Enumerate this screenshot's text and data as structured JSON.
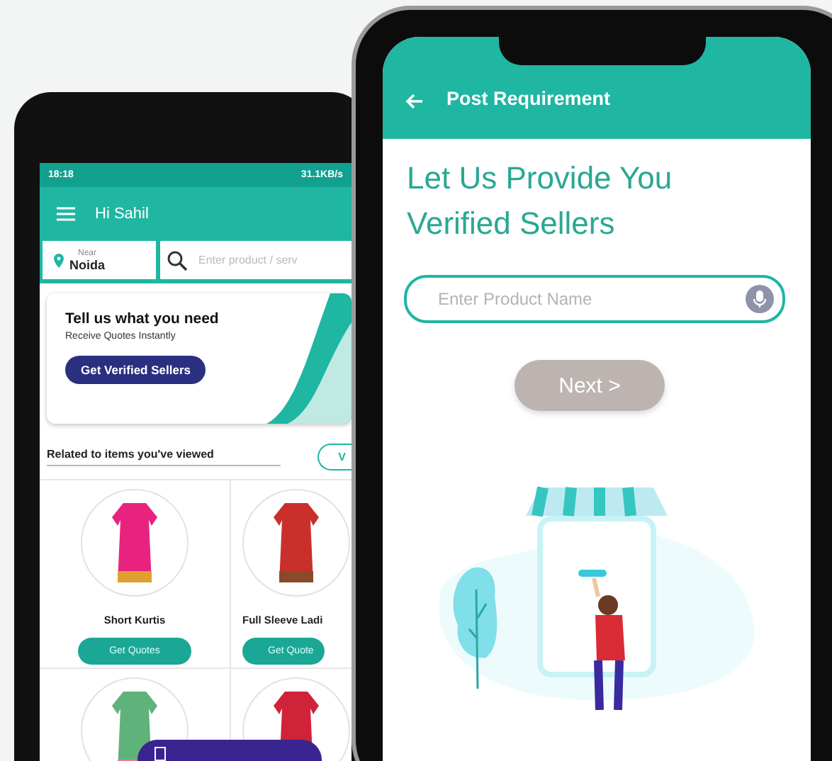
{
  "left_phone": {
    "status_bar": {
      "time": "18:18",
      "speed": "31.1KB/s"
    },
    "app_bar": {
      "title": "Hi Sahil"
    },
    "location": {
      "label": "Near",
      "city": "Noida"
    },
    "search": {
      "placeholder": "Enter product / serv"
    },
    "banner": {
      "title": "Tell us what you need",
      "subtitle": "Receive Quotes Instantly",
      "button": "Get Verified Sellers"
    },
    "section": {
      "title": "Related to items you've viewed",
      "button": "V"
    },
    "products": [
      {
        "kind": "full",
        "name": "Short Kurtis",
        "button": "Get Quotes"
      },
      {
        "kind": "full",
        "name": "Full Sleeve Ladi",
        "button": "Get Quote"
      },
      {
        "kind": "image"
      },
      {
        "kind": "image"
      }
    ]
  },
  "right_phone": {
    "app_bar": {
      "title": "Post Requirement"
    },
    "heading": "Let Us Provide You Verified Sellers",
    "field": {
      "placeholder": "Enter Product Name"
    },
    "next_button": "Next >"
  }
}
